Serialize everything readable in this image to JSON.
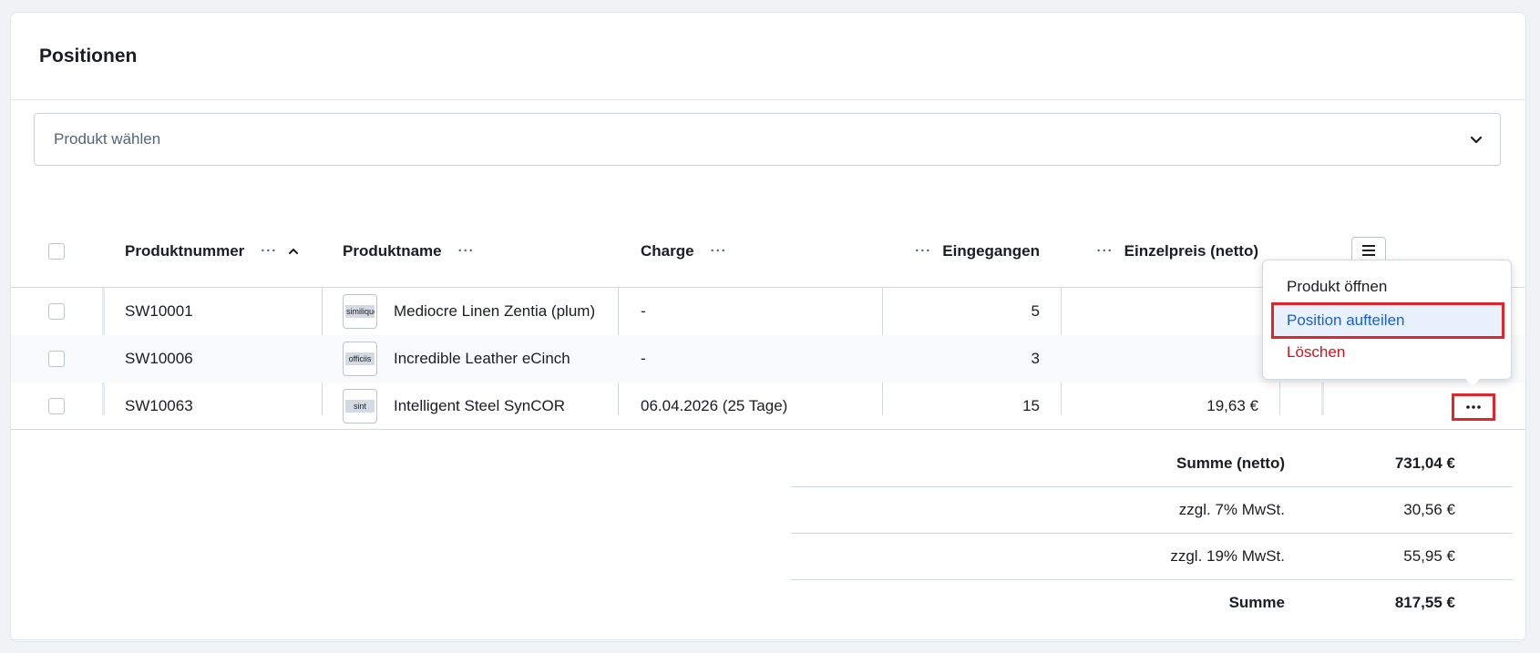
{
  "card": {
    "title": "Positionen"
  },
  "product_select": {
    "placeholder": "Produkt wählen"
  },
  "table": {
    "columns": {
      "product_number": "Produktnummer",
      "product_name": "Produktname",
      "batch": "Charge",
      "received": "Eingegangen",
      "unit_price": "Einzelpreis (netto)"
    },
    "column_menu_glyph": "···",
    "rows": [
      {
        "product_number": "SW10001",
        "thumb": "similique",
        "product_name": "Mediocre Linen Zentia (plum)",
        "batch": "-",
        "received": "5",
        "unit_price": ""
      },
      {
        "product_number": "SW10006",
        "thumb": "officiis",
        "product_name": "Incredible Leather eCinch",
        "batch": "-",
        "received": "3",
        "unit_price": ""
      },
      {
        "product_number": "SW10063",
        "thumb": "sint",
        "product_name": "Intelligent Steel SynCOR",
        "batch": "06.04.2026 (25 Tage)",
        "received": "15",
        "unit_price": "19,63 €"
      }
    ]
  },
  "context_menu": {
    "items": [
      {
        "label": "Produkt öffnen"
      },
      {
        "label": "Position aufteilen"
      },
      {
        "label": "Löschen"
      }
    ]
  },
  "summary": {
    "net_label": "Summe (netto)",
    "net_value": "731,04 €",
    "vat7_label": "zzgl. 7% MwSt.",
    "vat7_value": "30,56 €",
    "vat19_label": "zzgl. 19% MwSt.",
    "vat19_value": "55,95 €",
    "total_label": "Summe",
    "total_value": "817,55 €"
  },
  "colors": {
    "highlight_red": "#e0252b",
    "link_blue": "#1b5fd1",
    "danger_red": "#d0121d"
  }
}
